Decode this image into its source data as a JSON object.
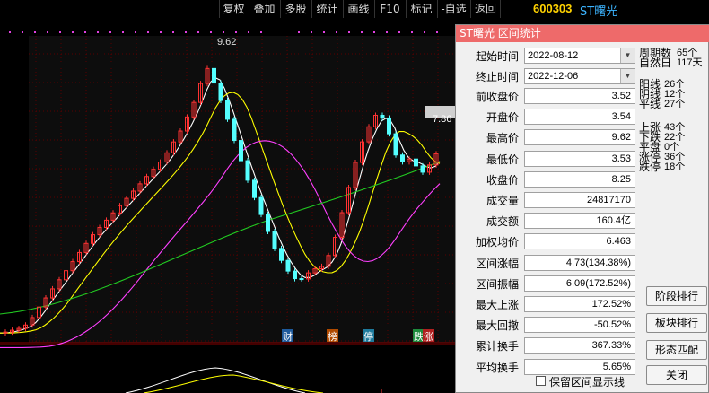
{
  "toolbar": {
    "buttons": [
      "复权",
      "叠加",
      "多股",
      "统计",
      "画线",
      "F10",
      "标记",
      "-自选",
      "返回"
    ]
  },
  "stock": {
    "code": "600303",
    "name": "ST曙光"
  },
  "chart": {
    "max_label": "9.62",
    "right_label": "7.86",
    "markers": [
      "财",
      "榜",
      "停",
      "跌",
      "涨"
    ],
    "colors": {
      "up": "#ff3232",
      "down": "#54ffff",
      "ma5": "#ffffff",
      "ma10": "#ffff00",
      "ma20": "#ff40ff",
      "ma60": "#22cc22",
      "grid": "#5a0000",
      "dot": "#e040e0"
    }
  },
  "dialog": {
    "title": "ST曙光 区间统计",
    "start_label": "起始时间",
    "start_value": "2022-08-12",
    "end_label": "终止时间",
    "end_value": "2022-12-06",
    "fields": [
      {
        "label": "前收盘价",
        "value": "3.52"
      },
      {
        "label": "开盘价",
        "value": "3.54"
      },
      {
        "label": "最高价",
        "value": "9.62"
      },
      {
        "label": "最低价",
        "value": "3.53"
      },
      {
        "label": "收盘价",
        "value": "8.25"
      },
      {
        "label": "成交量",
        "value": "24817170"
      },
      {
        "label": "成交额",
        "value": "160.4亿"
      },
      {
        "label": "加权均价",
        "value": "6.463"
      },
      {
        "label": "区间涨幅",
        "value": "4.73(134.38%)"
      },
      {
        "label": "区间振幅",
        "value": "6.09(172.52%)"
      },
      {
        "label": "最大上涨",
        "value": "172.52%"
      },
      {
        "label": "最大回撤",
        "value": "-50.52%"
      },
      {
        "label": "累计换手",
        "value": "367.33%"
      },
      {
        "label": "平均换手",
        "value": "5.65%"
      }
    ],
    "stats1": [
      {
        "label": "周期数",
        "value": "65个"
      },
      {
        "label": "自然日",
        "value": "117天"
      }
    ],
    "stats2": [
      {
        "label": "阳线",
        "value": "26个"
      },
      {
        "label": "阴线",
        "value": "12个"
      },
      {
        "label": "平线",
        "value": "27个"
      }
    ],
    "stats3": [
      {
        "label": "上涨",
        "value": "43个"
      },
      {
        "label": "下跌",
        "value": "22个"
      },
      {
        "label": "平盘",
        "value": "0个"
      },
      {
        "label": "涨停",
        "value": "36个"
      },
      {
        "label": "跌停",
        "value": "18个"
      }
    ],
    "buttons": [
      "阶段排行",
      "板块排行",
      "形态匹配",
      "关闭"
    ],
    "keep_label": "保留区间显示线"
  }
}
